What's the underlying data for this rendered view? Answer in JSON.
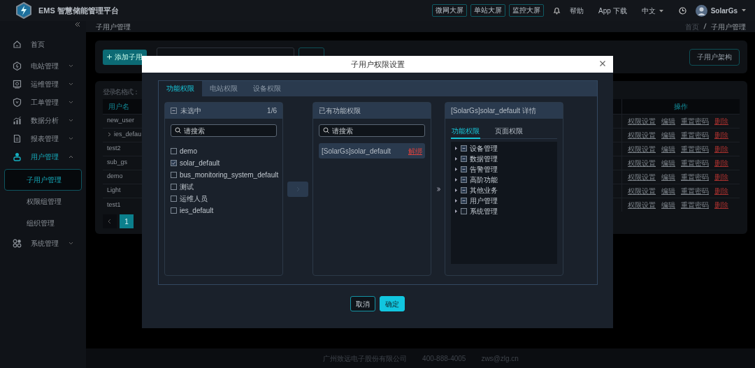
{
  "app": {
    "title": "EMS 智慧储能管理平台"
  },
  "top_buttons": [
    "微网大屏",
    "单站大屏",
    "监控大屏"
  ],
  "top_links": [
    {
      "label": "帮助",
      "dropdown": false
    },
    {
      "label": "App 下载",
      "dropdown": false
    },
    {
      "label": "中文",
      "dropdown": true
    }
  ],
  "user": {
    "name": "SolarGs"
  },
  "sidebar": {
    "items": [
      {
        "label": "首页",
        "expandable": false,
        "expanded": false
      },
      {
        "label": "电站管理",
        "expandable": true,
        "expanded": false
      },
      {
        "label": "运维管理",
        "expandable": true,
        "expanded": false
      },
      {
        "label": "工单管理",
        "expandable": true,
        "expanded": false
      },
      {
        "label": "数据分析",
        "expandable": true,
        "expanded": false
      },
      {
        "label": "报表管理",
        "expandable": true,
        "expanded": false
      },
      {
        "label": "用户管理",
        "expandable": true,
        "expanded": true,
        "children": [
          {
            "label": "子用户管理",
            "selected": true
          },
          {
            "label": "权限组管理",
            "selected": false
          },
          {
            "label": "组织管理",
            "selected": false
          }
        ]
      },
      {
        "label": "系统管理",
        "expandable": true,
        "expanded": false
      }
    ]
  },
  "breadcrumb": {
    "page_title": "子用户管理",
    "path": [
      "首页",
      "子用户管理"
    ]
  },
  "toolbar": {
    "add_button": "添加子用",
    "structure_button": "子用户架构"
  },
  "table": {
    "note": "登录名格式：",
    "columns": [
      "用户名",
      "操作"
    ],
    "rows": [
      {
        "name": "new_user",
        "expandable": false,
        "actions": [
          {
            "label": "权限设置",
            "danger": false
          },
          {
            "label": "编辑",
            "danger": false
          },
          {
            "label": "重置密码",
            "danger": false
          },
          {
            "label": "删除",
            "danger": true
          }
        ]
      },
      {
        "name": "ies_defau",
        "expandable": true,
        "actions": [
          {
            "label": "权限设置",
            "danger": false
          },
          {
            "label": "编辑",
            "danger": false
          },
          {
            "label": "重置密码",
            "danger": false
          },
          {
            "label": "删除",
            "danger": true
          }
        ]
      },
      {
        "name": "test2",
        "expandable": false,
        "actions": [
          {
            "label": "权限设置",
            "danger": false
          },
          {
            "label": "编辑",
            "danger": false
          },
          {
            "label": "重置密码",
            "danger": false
          },
          {
            "label": "删除",
            "danger": true
          }
        ]
      },
      {
        "name": "sub_gs",
        "expandable": false,
        "actions": [
          {
            "label": "权限设置",
            "danger": false
          },
          {
            "label": "编辑",
            "danger": false
          },
          {
            "label": "重置密码",
            "danger": false
          },
          {
            "label": "删除",
            "danger": true
          }
        ]
      },
      {
        "name": "demo",
        "expandable": false,
        "actions": [
          {
            "label": "权限设置",
            "danger": false
          },
          {
            "label": "编辑",
            "danger": false
          },
          {
            "label": "重置密码",
            "danger": false
          },
          {
            "label": "删除",
            "danger": true
          }
        ]
      },
      {
        "name": "Light",
        "expandable": false,
        "actions": [
          {
            "label": "权限设置",
            "danger": false
          },
          {
            "label": "编辑",
            "danger": false
          },
          {
            "label": "重置密码",
            "danger": false
          },
          {
            "label": "删除",
            "danger": true
          }
        ]
      },
      {
        "name": "test1",
        "expandable": false,
        "actions": [
          {
            "label": "权限设置",
            "danger": false
          },
          {
            "label": "编辑",
            "danger": false
          },
          {
            "label": "重置密码",
            "danger": false
          },
          {
            "label": "删除",
            "danger": true
          }
        ]
      }
    ]
  },
  "pagination": {
    "pages": [
      {
        "label": "1",
        "selected": true
      }
    ]
  },
  "modal": {
    "title": "子用户权限设置",
    "tabs": [
      {
        "label": "功能权限",
        "selected": true
      },
      {
        "label": "电站权限",
        "selected": false
      },
      {
        "label": "设备权限",
        "selected": false
      }
    ],
    "source": {
      "title": "未选中",
      "indeterminate": true,
      "count": "1/6",
      "placeholder": "请搜索",
      "items": [
        {
          "label": "demo",
          "checked": false
        },
        {
          "label": "solar_default",
          "checked": true
        },
        {
          "label": "bus_monitoring_system_default",
          "checked": false
        },
        {
          "label": "测试",
          "checked": false
        },
        {
          "label": "运维人员",
          "checked": false
        },
        {
          "label": "ies_default",
          "checked": false
        }
      ]
    },
    "transfer_enabled": false,
    "target": {
      "title": "已有功能权限",
      "placeholder": "请搜索",
      "items": [
        {
          "label": "[SolarGs]solar_default",
          "action": "解绑"
        }
      ]
    },
    "detail": {
      "title": "[SolarGs]solar_default 详情",
      "tabs": [
        {
          "label": "功能权限",
          "selected": true
        },
        {
          "label": "页面权限",
          "selected": false
        }
      ],
      "tree": [
        {
          "label": "设备管理",
          "expanded": false,
          "indeterminate": true
        },
        {
          "label": "数据管理",
          "expanded": false,
          "indeterminate": true
        },
        {
          "label": "告警管理",
          "expanded": false,
          "indeterminate": true
        },
        {
          "label": "高阶功能",
          "expanded": false,
          "indeterminate": true
        },
        {
          "label": "其他业务",
          "expanded": false,
          "indeterminate": true
        },
        {
          "label": "用户管理",
          "expanded": false,
          "indeterminate": true
        },
        {
          "label": "系统管理",
          "expanded": false,
          "indeterminate": false
        }
      ]
    },
    "buttons": [
      {
        "label": "取消",
        "kind": "secondary"
      },
      {
        "label": "确定",
        "kind": "primary"
      }
    ]
  },
  "footer": [
    "广州致远电子股份有限公司",
    "400-888-4005",
    "zws@zlg.cn"
  ]
}
